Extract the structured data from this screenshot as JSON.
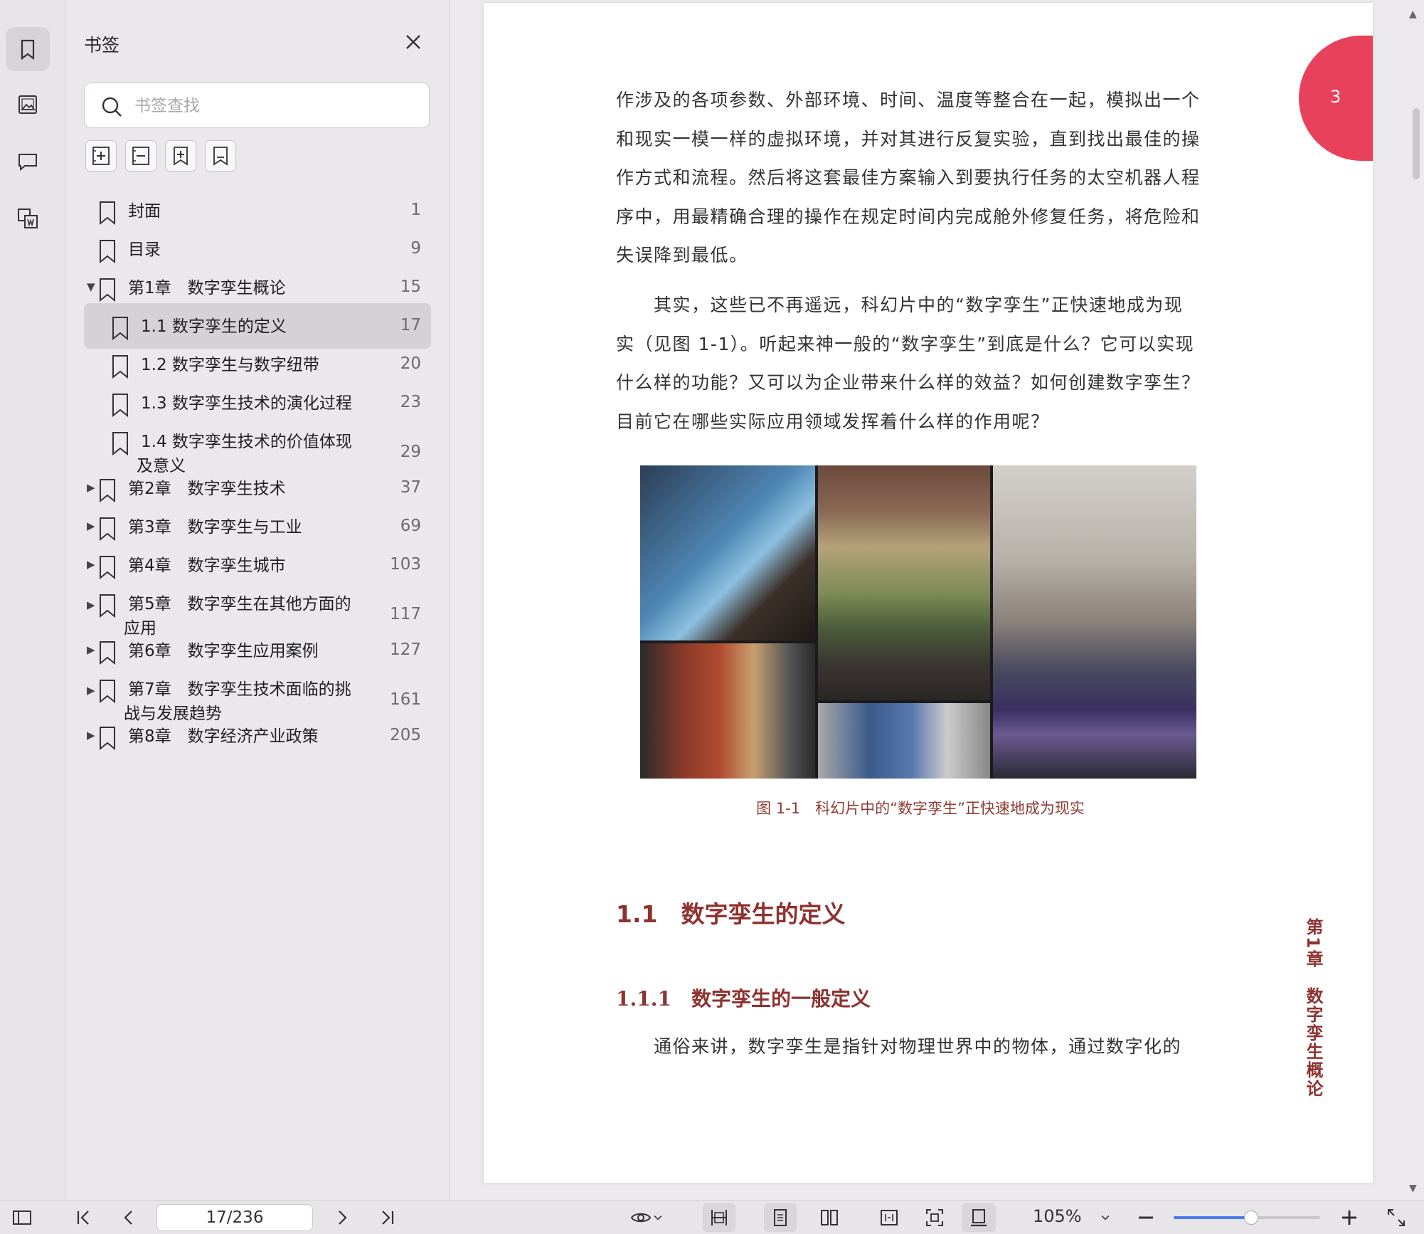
{
  "rail": {
    "items": [
      {
        "name": "bookmarks",
        "icon": "bookmark-icon",
        "active": true
      },
      {
        "name": "thumbnails",
        "icon": "image-icon",
        "active": false
      },
      {
        "name": "comments",
        "icon": "comment-icon",
        "active": false
      },
      {
        "name": "outline",
        "icon": "doc-copy-icon",
        "active": false
      }
    ]
  },
  "panel": {
    "title": "书签",
    "search_placeholder": "书签查找",
    "tools": [
      "expand-all-icon",
      "collapse-all-icon",
      "add-bookmark-icon",
      "bookmark-outline-icon"
    ],
    "bookmarks": [
      {
        "label": "封面",
        "page": "1",
        "level": 0,
        "expander": "none"
      },
      {
        "label": "目录",
        "page": "9",
        "level": 0,
        "expander": "none"
      },
      {
        "label": "第1章　数字孪生概论",
        "page": "15",
        "level": 0,
        "expander": "expanded"
      },
      {
        "label": "1.1 数字孪生的定义",
        "page": "17",
        "level": 1,
        "expander": "none",
        "selected": true
      },
      {
        "label": "1.2 数字孪生与数字纽带",
        "page": "20",
        "level": 1,
        "expander": "none"
      },
      {
        "label": "1.3 数字孪生技术的演化过程",
        "page": "23",
        "level": 1,
        "expander": "none"
      },
      {
        "label": "1.4 数字孪生技术的价值体现",
        "label2": "及意义",
        "page": "29",
        "level": 1,
        "expander": "none"
      },
      {
        "label": "第2章　数字孪生技术",
        "page": "37",
        "level": 0,
        "expander": "collapsed"
      },
      {
        "label": "第3章　数字孪生与工业",
        "page": "69",
        "level": 0,
        "expander": "collapsed"
      },
      {
        "label": "第4章　数字孪生城市",
        "page": "103",
        "level": 0,
        "expander": "collapsed"
      },
      {
        "label": "第5章　数字孪生在其他方面的",
        "label2": "应用",
        "page": "117",
        "level": 0,
        "expander": "collapsed"
      },
      {
        "label": "第6章　数字孪生应用案例",
        "page": "127",
        "level": 0,
        "expander": "collapsed"
      },
      {
        "label": "第7章　数字孪生技术面临的挑",
        "label2": "战与发展趋势",
        "page": "161",
        "level": 0,
        "expander": "collapsed"
      },
      {
        "label": "第8章　数字经济产业政策",
        "page": "205",
        "level": 0,
        "expander": "collapsed"
      }
    ]
  },
  "document": {
    "page_badge": "3",
    "para1": [
      "作涉及的各项参数、外部环境、时间、温度等整合在一起，模拟出一个",
      "和现实一模一样的虚拟环境，并对其进行反复实验，直到找出最佳的操",
      "作方式和流程。然后将这套最佳方案输入到要执行任务的太空机器人程",
      "序中，用最精确合理的操作在规定时间内完成舱外修复任务，将危险和",
      "失误降到最低。"
    ],
    "para2": [
      "　　其实，这些已不再遥远，科幻片中的“数字孪生”正快速地成为现",
      "实（见图 1-1）。听起来神一般的“数字孪生”到底是什么？它可以实现",
      "什么样的功能？又可以为企业带来什么样的效益？如何创建数字孪生？",
      "目前它在哪些实际应用领域发挥着什么样的作用呢？"
    ],
    "figure_caption": "图 1-1　科幻片中的“数字孪生”正快速地成为现实",
    "heading1": "1.1　数字孪生的定义",
    "heading2": "1.1.1　数字孪生的一般定义",
    "para3": "　　通俗来讲，数字孪生是指针对物理世界中的物体，通过数字化的",
    "side_label": "第1章　数字孪生概论"
  },
  "toolbar": {
    "page_value": "17/236",
    "zoom": "105%",
    "zoom_fraction": 0.53,
    "accent": "#4a7bf1"
  }
}
